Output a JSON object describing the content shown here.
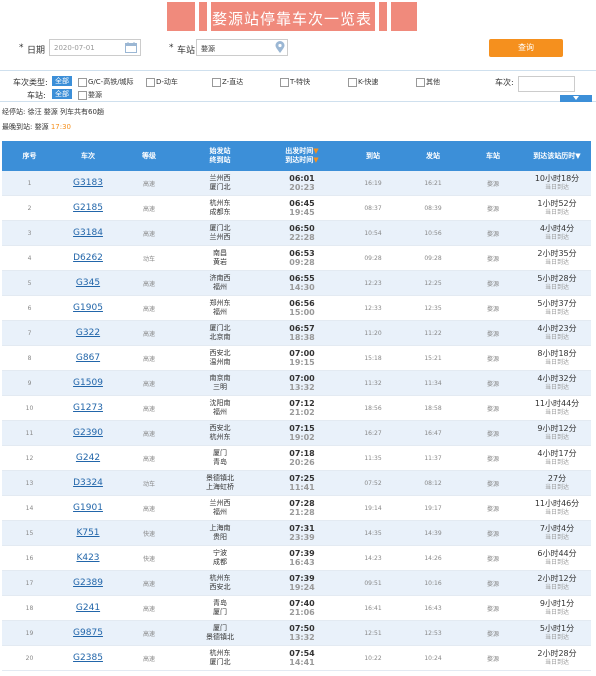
{
  "page": {
    "title": "婺源站停靠车次一览表"
  },
  "search": {
    "date_label": "日期",
    "date_value": "2020-07-01",
    "station_label": "车站",
    "station_value": "婺源",
    "query_label": "查询",
    "required_mark": "*"
  },
  "filter": {
    "type_label": "车次类型:",
    "all_label": "全部",
    "types": [
      "G/C-高铁/城际",
      "D-动车",
      "Z-直达",
      "T-特快",
      "K-快速",
      "其他"
    ],
    "station_label": "车站:",
    "station_all": "全部",
    "station_option": "婺源",
    "number_label": "车次:"
  },
  "info": {
    "first_line": "经停站: 徐汪 婺源 列车共有60趟",
    "last_label": "最晚到站: 婺源",
    "last_time": "17:30"
  },
  "table": {
    "headers": {
      "no": "序号",
      "train": "车次",
      "grade": "等级",
      "stations_1": "始发站",
      "stations_2": "终到站",
      "times_1": "出发时间",
      "times_2": "到达时间",
      "arrive": "到站",
      "depart": "发站",
      "station": "车站",
      "duration": "到达该站历时"
    },
    "sort_arrow": "▼",
    "rows": [
      {
        "no": "1",
        "train": "G3183",
        "grade": "高速",
        "from": "兰州西",
        "to": "厦门北",
        "dep": "06:01",
        "arr": "20:23",
        "in": "16:19",
        "out": "16:21",
        "station": "婺源",
        "dur": "10小时18分",
        "sub": "当日到达"
      },
      {
        "no": "2",
        "train": "G2185",
        "grade": "高速",
        "from": "杭州东",
        "to": "成都东",
        "dep": "06:45",
        "arr": "19:45",
        "in": "08:37",
        "out": "08:39",
        "station": "婺源",
        "dur": "1小时52分",
        "sub": "当日到达"
      },
      {
        "no": "3",
        "train": "G3184",
        "grade": "高速",
        "from": "厦门北",
        "to": "兰州西",
        "dep": "06:50",
        "arr": "22:28",
        "in": "10:54",
        "out": "10:56",
        "station": "婺源",
        "dur": "4小时4分",
        "sub": "当日到达"
      },
      {
        "no": "4",
        "train": "D6262",
        "grade": "动车",
        "from": "南昌",
        "to": "黄岩",
        "dep": "06:53",
        "arr": "09:28",
        "in": "09:28",
        "out": "09:28",
        "station": "婺源",
        "dur": "2小时35分",
        "sub": "当日到达"
      },
      {
        "no": "5",
        "train": "G345",
        "grade": "高速",
        "from": "济南西",
        "to": "福州",
        "dep": "06:55",
        "arr": "14:30",
        "in": "12:23",
        "out": "12:25",
        "station": "婺源",
        "dur": "5小时28分",
        "sub": "当日到达"
      },
      {
        "no": "6",
        "train": "G1905",
        "grade": "高速",
        "from": "郑州东",
        "to": "福州",
        "dep": "06:56",
        "arr": "15:00",
        "in": "12:33",
        "out": "12:35",
        "station": "婺源",
        "dur": "5小时37分",
        "sub": "当日到达"
      },
      {
        "no": "7",
        "train": "G322",
        "grade": "高速",
        "from": "厦门北",
        "to": "北京南",
        "dep": "06:57",
        "arr": "18:38",
        "in": "11:20",
        "out": "11:22",
        "station": "婺源",
        "dur": "4小时23分",
        "sub": "当日到达"
      },
      {
        "no": "8",
        "train": "G867",
        "grade": "高速",
        "from": "西安北",
        "to": "温州南",
        "dep": "07:00",
        "arr": "19:15",
        "in": "15:18",
        "out": "15:21",
        "station": "婺源",
        "dur": "8小时18分",
        "sub": "当日到达"
      },
      {
        "no": "9",
        "train": "G1509",
        "grade": "高速",
        "from": "南京南",
        "to": "三明",
        "dep": "07:00",
        "arr": "13:32",
        "in": "11:32",
        "out": "11:34",
        "station": "婺源",
        "dur": "4小时32分",
        "sub": "当日到达"
      },
      {
        "no": "10",
        "train": "G1273",
        "grade": "高速",
        "from": "沈阳南",
        "to": "福州",
        "dep": "07:12",
        "arr": "21:02",
        "in": "18:56",
        "out": "18:58",
        "station": "婺源",
        "dur": "11小时44分",
        "sub": "当日到达"
      },
      {
        "no": "11",
        "train": "G2390",
        "grade": "高速",
        "from": "西安北",
        "to": "杭州东",
        "dep": "07:15",
        "arr": "19:02",
        "in": "16:27",
        "out": "16:47",
        "station": "婺源",
        "dur": "9小时12分",
        "sub": "当日到达"
      },
      {
        "no": "12",
        "train": "G242",
        "grade": "高速",
        "from": "厦门",
        "to": "青岛",
        "dep": "07:18",
        "arr": "20:26",
        "in": "11:35",
        "out": "11:37",
        "station": "婺源",
        "dur": "4小时17分",
        "sub": "当日到达"
      },
      {
        "no": "13",
        "train": "D3324",
        "grade": "动车",
        "from": "景德镇北",
        "to": "上海虹桥",
        "dep": "07:25",
        "arr": "11:41",
        "in": "07:52",
        "out": "08:12",
        "station": "婺源",
        "dur": "27分",
        "sub": "当日到达"
      },
      {
        "no": "14",
        "train": "G1901",
        "grade": "高速",
        "from": "兰州西",
        "to": "福州",
        "dep": "07:28",
        "arr": "21:28",
        "in": "19:14",
        "out": "19:17",
        "station": "婺源",
        "dur": "11小时46分",
        "sub": "当日到达"
      },
      {
        "no": "15",
        "train": "K751",
        "grade": "快速",
        "from": "上海南",
        "to": "贵阳",
        "dep": "07:31",
        "arr": "23:39",
        "in": "14:35",
        "out": "14:39",
        "station": "婺源",
        "dur": "7小时4分",
        "sub": "当日到达"
      },
      {
        "no": "16",
        "train": "K423",
        "grade": "快速",
        "from": "宁波",
        "to": "成都",
        "dep": "07:39",
        "arr": "16:43",
        "in": "14:23",
        "out": "14:26",
        "station": "婺源",
        "dur": "6小时44分",
        "sub": "当日到达"
      },
      {
        "no": "17",
        "train": "G2389",
        "grade": "高速",
        "from": "杭州东",
        "to": "西安北",
        "dep": "07:39",
        "arr": "19:24",
        "in": "09:51",
        "out": "10:16",
        "station": "婺源",
        "dur": "2小时12分",
        "sub": "当日到达"
      },
      {
        "no": "18",
        "train": "G241",
        "grade": "高速",
        "from": "青岛",
        "to": "厦门",
        "dep": "07:40",
        "arr": "21:06",
        "in": "16:41",
        "out": "16:43",
        "station": "婺源",
        "dur": "9小时1分",
        "sub": "当日到达"
      },
      {
        "no": "19",
        "train": "G9875",
        "grade": "高速",
        "from": "厦门",
        "to": "景德镇北",
        "dep": "07:50",
        "arr": "13:32",
        "in": "12:51",
        "out": "12:53",
        "station": "婺源",
        "dur": "5小时1分",
        "sub": "当日到达"
      },
      {
        "no": "20",
        "train": "G2385",
        "grade": "高速",
        "from": "杭州东",
        "to": "厦门北",
        "dep": "07:54",
        "arr": "14:41",
        "in": "10:22",
        "out": "10:24",
        "station": "婺源",
        "dur": "2小时28分",
        "sub": "当日到达"
      }
    ]
  },
  "colors": {
    "accent": "#3c8fd8",
    "banner": "#f08a7c",
    "query_button": "#f5901e",
    "time_highlight": "#f5901e"
  },
  "icons": {
    "calendar": "calendar-icon",
    "location": "location-pin-icon",
    "sort": "sort-down-icon"
  }
}
